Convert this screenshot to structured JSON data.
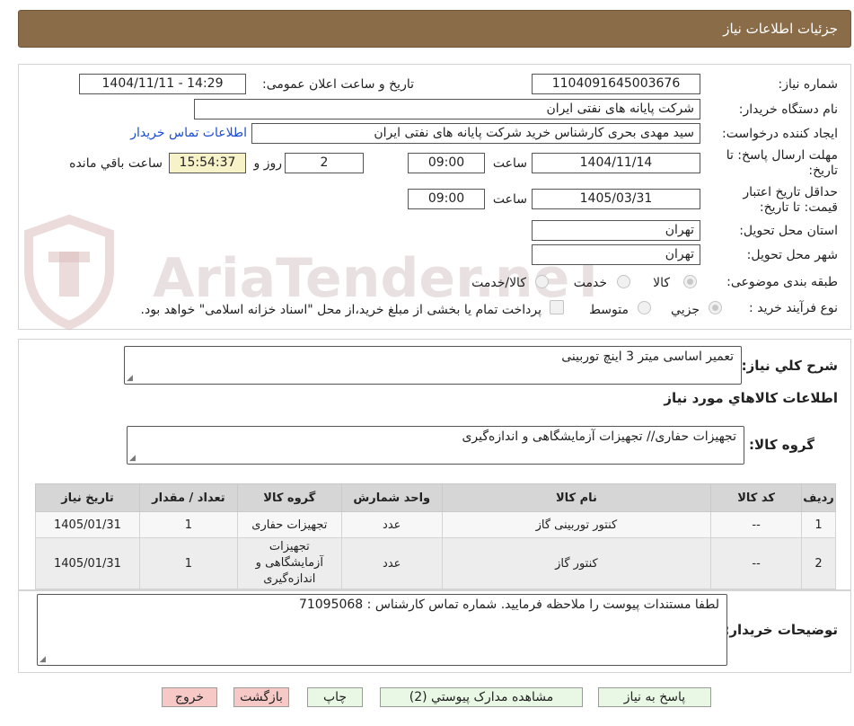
{
  "header": {
    "title": "جزئیات اطلاعات نیاز"
  },
  "details": {
    "need_number_label": "شماره نیاز:",
    "need_number": "1104091645003676",
    "announce_label": "تاریخ و ساعت اعلان عمومی:",
    "announce_value": "1404/11/11 - 14:29",
    "buyer_label": "نام دستگاه خریدار:",
    "buyer_value": "شرکت پایانه های نفتی ایران",
    "requester_label": "ایجاد کننده درخواست:",
    "requester_value": "سید مهدی  بحری کارشناس خرید شرکت پایانه های نفتی ایران",
    "contact_link": "اطلاعات تماس خریدار",
    "deadline_label": "مهلت ارسال پاسخ: تا تاریخ:",
    "deadline_date": "1404/11/14",
    "time_label": "ساعت",
    "deadline_time": "09:00",
    "days_value": "2",
    "days_label": "روز و",
    "remaining_time": "15:54:37",
    "remaining_label": "ساعت باقي مانده",
    "validity_label": "حداقل تاریخ اعتبار قیمت: تا تاریخ:",
    "validity_date": "1405/03/31",
    "validity_time": "09:00",
    "province_label": "استان محل تحویل:",
    "province_value": "تهران",
    "city_label": "شهر محل تحویل:",
    "city_value": "تهران",
    "category_label": "طبقه بندی موضوعی:",
    "category_options": [
      "کالا",
      "خدمت",
      "کالا/خدمت"
    ],
    "category_selected": "کالا",
    "process_label": "نوع فرآیند خرید :",
    "process_options": [
      "جزیي",
      "متوسط"
    ],
    "process_selected": "جزیي",
    "payment_note": "پرداخت تمام یا بخشی از مبلغ خرید،از محل \"اسناد خزانه اسلامی\" خواهد بود."
  },
  "summary": {
    "label": "شرح کلي نياز:",
    "value": "تعمیر اساسی میتر 3 اینچ توربینی"
  },
  "goods_info": {
    "heading": "اطلاعات کالاهاي مورد نياز",
    "group_label": "گروه کالا:",
    "group_value": "تجهیزات حفاری// تجهیزات آزمایشگاهی و اندازه‌گیری"
  },
  "table": {
    "headers": [
      "رديف",
      "کد کالا",
      "نام کالا",
      "واحد شمارش",
      "گروه کالا",
      "تعداد / مقدار",
      "تاریخ نیاز"
    ],
    "rows": [
      [
        "1",
        "--",
        "کنتور توربینی گاز",
        "عدد",
        "تجهیزات حفاری",
        "1",
        "1405/01/31"
      ],
      [
        "2",
        "--",
        "کنتور گاز",
        "عدد",
        "تجهیزات آزمایشگاهی و اندازه‌گیری",
        "1",
        "1405/01/31"
      ]
    ]
  },
  "buyer_notes": {
    "label": "توضیحات خریدار:",
    "value": "لطفا مستندات پیوست را ملاحظه فرمایید. شماره تماس کارشناس : 71095068"
  },
  "buttons": {
    "reply": "پاسخ به نیاز",
    "attachments": "مشاهده مدارک پیوستي (2)",
    "print": "چاپ",
    "back": "بازگشت",
    "exit": "خروج"
  },
  "watermark": {
    "text": "AriaTender.neT"
  },
  "colors": {
    "header_bg": "#8a6d48",
    "button_green": "#e9f7e5",
    "button_red": "#f6c9c6",
    "link": "#1a4cd6"
  }
}
